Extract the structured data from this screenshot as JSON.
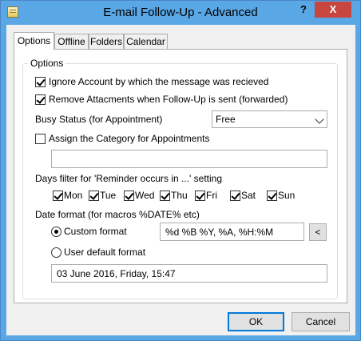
{
  "window": {
    "title": "E-mail Follow-Up - Advanced",
    "help_label": "?",
    "close_label": "X"
  },
  "tabs": [
    {
      "label": "Options",
      "active": true
    },
    {
      "label": "Offline",
      "active": false
    },
    {
      "label": "Folders",
      "active": false
    },
    {
      "label": "Calendar",
      "active": false
    }
  ],
  "options": {
    "group_label": "Options",
    "ignore_account": {
      "label": "Ignore Account by which the message was recieved",
      "checked": true
    },
    "remove_attachments": {
      "label": "Remove Attacments when Follow-Up is sent (forwarded)",
      "checked": true
    },
    "busy_status": {
      "label": "Busy Status (for Appointment)",
      "value": "Free"
    },
    "assign_category": {
      "label": "Assign the Category for Appointments",
      "checked": false,
      "value": ""
    },
    "days_filter": {
      "label": "Days filter for 'Reminder occurs in ...' setting",
      "days": [
        {
          "label": "Mon",
          "checked": true
        },
        {
          "label": "Tue",
          "checked": true
        },
        {
          "label": "Wed",
          "checked": true
        },
        {
          "label": "Thu",
          "checked": true
        },
        {
          "label": "Fri",
          "checked": true
        },
        {
          "label": "Sat",
          "checked": true
        },
        {
          "label": "Sun",
          "checked": true
        }
      ]
    },
    "date_format": {
      "label": "Date format (for macros %DATE% etc)",
      "custom_label": "Custom format",
      "custom_value": "%d %B %Y, %A, %H:%M",
      "custom_selected": true,
      "insert_button": "<",
      "user_default_label": "User default format",
      "preview": "03 June 2016, Friday, 15:47"
    }
  },
  "buttons": {
    "ok": "OK",
    "cancel": "Cancel"
  }
}
